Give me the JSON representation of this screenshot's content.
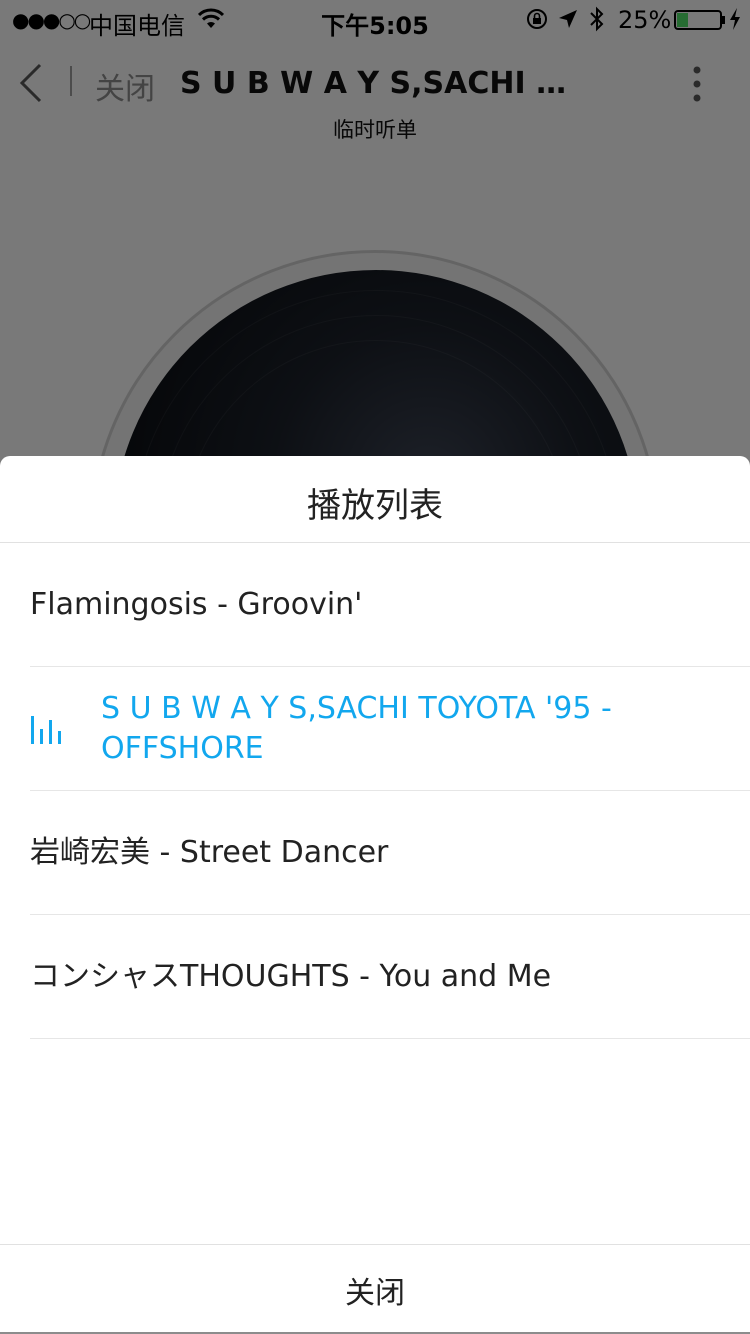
{
  "status_bar": {
    "signal": "●●●○○",
    "carrier": "中国电信",
    "time": "下午5:05",
    "battery_percent": "25%"
  },
  "nav": {
    "close_label": "关闭",
    "song_title": "S U B W A Y S,SACHI TOYOTA '95 - OFFSHORE",
    "subtitle": "临时听单"
  },
  "playlist": {
    "title": "播放列表",
    "tracks": [
      {
        "label": "Flamingosis - Groovin'",
        "active": false
      },
      {
        "label": "S U B W A Y S,SACHI TOYOTA '95 - OFFSHORE",
        "active": true
      },
      {
        "label": "岩崎宏美 - Street Dancer",
        "active": false
      },
      {
        "label": "コンシャスTHOUGHTS - You and Me",
        "active": false
      }
    ],
    "close_label": "关闭"
  },
  "colors": {
    "accent": "#12a7ee",
    "battery_fill": "#4cd964"
  },
  "icons": [
    "wifi-icon",
    "rotation-lock-icon",
    "location-arrow-icon",
    "bluetooth-icon",
    "battery-icon",
    "charging-bolt-icon",
    "back-chevron-icon",
    "more-vertical-icon",
    "now-playing-bars-icon"
  ]
}
